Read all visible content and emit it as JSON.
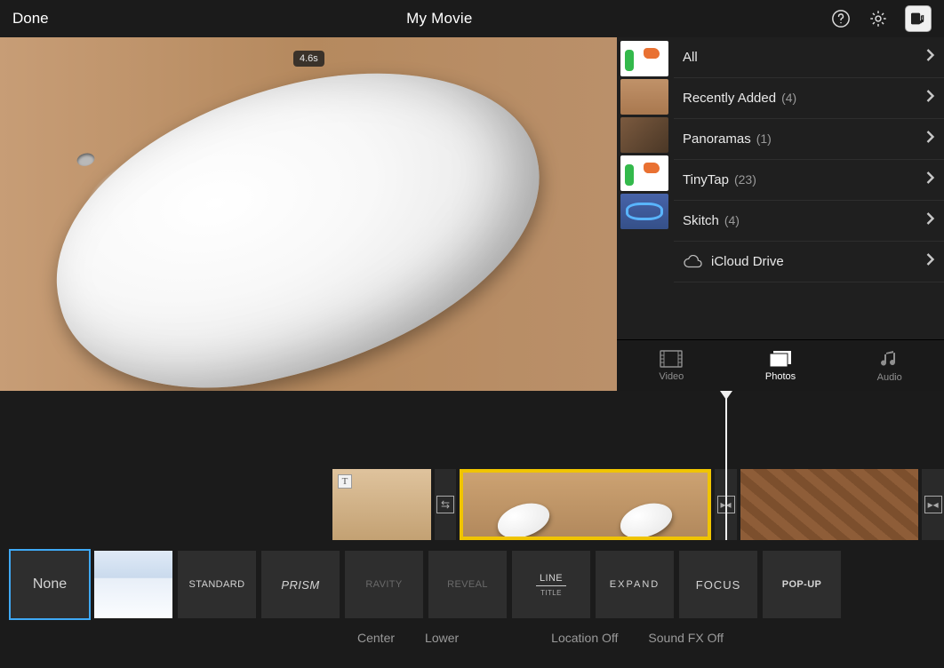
{
  "header": {
    "done": "Done",
    "title": "My Movie"
  },
  "preview": {
    "duration": "4.6s"
  },
  "browser": {
    "albums": [
      {
        "name": "All",
        "count": ""
      },
      {
        "name": "Recently Added",
        "count": "(4)"
      },
      {
        "name": "Panoramas",
        "count": "(1)"
      },
      {
        "name": "TinyTap",
        "count": "(23)"
      },
      {
        "name": "Skitch",
        "count": "(4)"
      },
      {
        "name": "iCloud Drive",
        "count": ""
      }
    ],
    "tabs": {
      "video": "Video",
      "photos": "Photos",
      "audio": "Audio"
    }
  },
  "titles": {
    "options": [
      {
        "label": "None",
        "key": "none"
      },
      {
        "label": "",
        "key": "image"
      },
      {
        "label": "STANDARD",
        "key": "standard"
      },
      {
        "label": "PRISM",
        "key": "prism"
      },
      {
        "label": "RAVITY",
        "key": "gravity"
      },
      {
        "label": "REVEAL",
        "key": "reveal"
      },
      {
        "label": "LINE",
        "sub": "TITLE",
        "key": "linetitle"
      },
      {
        "label": "EXPAND",
        "key": "expand"
      },
      {
        "label": "FOCUS",
        "key": "focus"
      },
      {
        "label": "POP-UP",
        "key": "popup"
      }
    ],
    "opts": {
      "center": "Center",
      "lower": "Lower",
      "location": "Location Off",
      "soundfx": "Sound FX Off"
    },
    "selected": "none"
  }
}
